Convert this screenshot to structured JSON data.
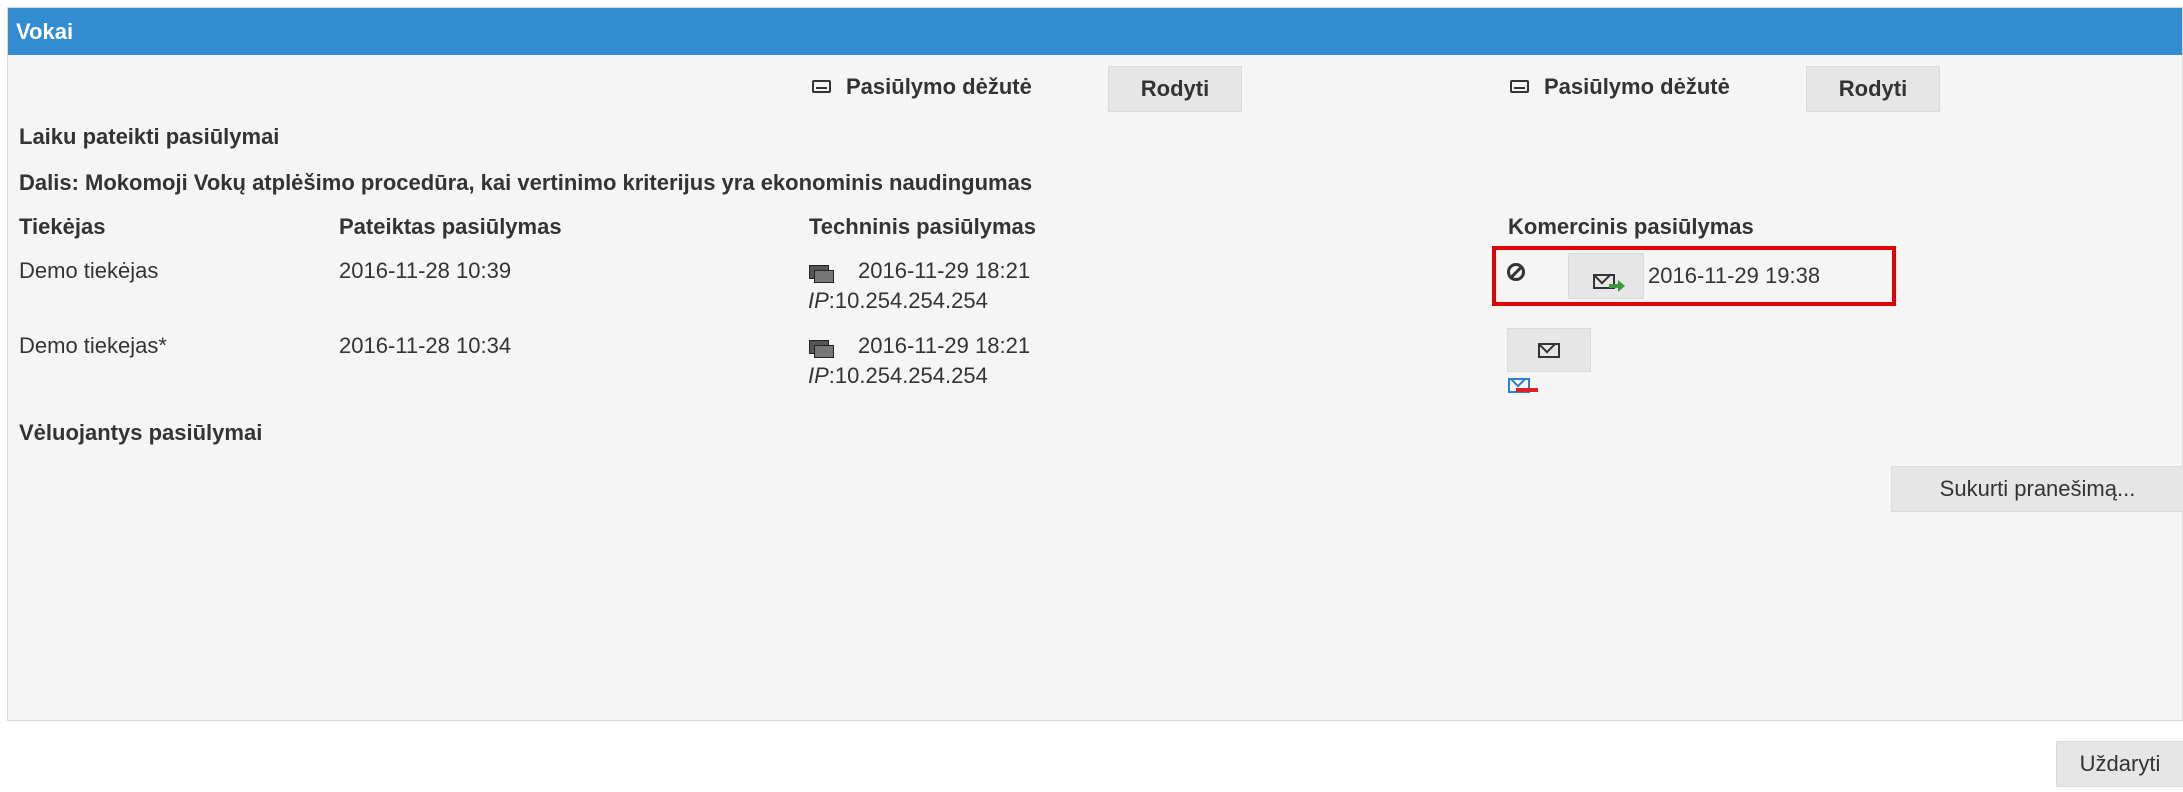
{
  "panel": {
    "title": "Vokai"
  },
  "mailbox": {
    "technical": {
      "label": "Pasiūlymo dėžutė",
      "button": "Rodyti",
      "icon": "inbox-icon"
    },
    "commercial": {
      "label": "Pasiūlymo dėžutė",
      "button": "Rodyti",
      "icon": "inbox-icon"
    }
  },
  "sections": {
    "on_time": "Laiku pateikti pasiūlymai",
    "lot": "Dalis: Mokomoji Vokų atplėšimo procedūra, kai vertinimo kriterijus yra ekonominis naudingumas",
    "late": "Vėluojantys pasiūlymai"
  },
  "table": {
    "headers": [
      "Tiekėjas",
      "Pateiktas pasiūlymas",
      "Techninis pasiūlymas",
      "Komercinis pasiūlymas"
    ],
    "rows": [
      {
        "supplier": "Demo tiekėjas",
        "submitted": "2016-11-28 10:39",
        "technical_time": "2016-11-29 18:21",
        "technical_ip_label": "IP",
        "technical_ip": ":10.254.254.254",
        "commercial_time": "2016-11-29 19:38"
      },
      {
        "supplier": "Demo tiekejas*",
        "submitted": "2016-11-28 10:34",
        "technical_time": "2016-11-29 18:21",
        "technical_ip_label": "IP",
        "technical_ip": ":10.254.254.254"
      }
    ]
  },
  "buttons": {
    "create_message": "Sukurti pranešimą...",
    "close": "Uždaryti"
  },
  "colors": {
    "header_bg": "#338ccf",
    "highlight": "#e00000"
  }
}
